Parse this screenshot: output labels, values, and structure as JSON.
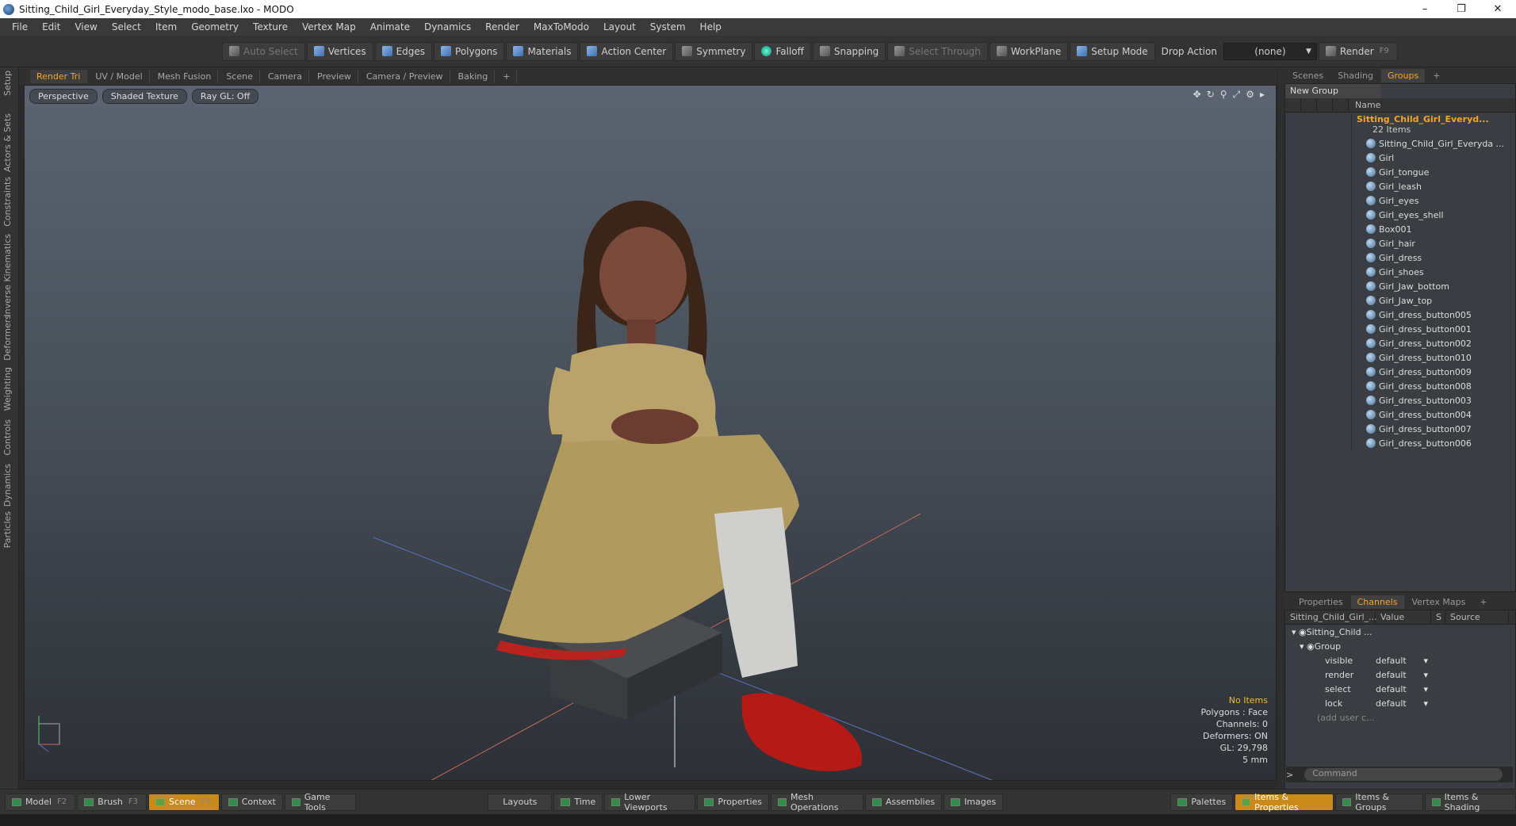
{
  "window": {
    "title": "Sitting_Child_Girl_Everyday_Style_modo_base.lxo - MODO",
    "minimize": "–",
    "maximize": "❐",
    "close": "✕"
  },
  "menu": [
    "File",
    "Edit",
    "View",
    "Select",
    "Item",
    "Geometry",
    "Texture",
    "Vertex Map",
    "Animate",
    "Dynamics",
    "Render",
    "MaxToModo",
    "Layout",
    "System",
    "Help"
  ],
  "toolbar": {
    "auto_select": "Auto Select",
    "vertices": "Vertices",
    "edges": "Edges",
    "polygons": "Polygons",
    "materials": "Materials",
    "action_center": "Action Center",
    "symmetry": "Symmetry",
    "falloff": "Falloff",
    "snapping": "Snapping",
    "select_through": "Select Through",
    "workplane": "WorkPlane",
    "setup_mode": "Setup Mode",
    "drop_action_label": "Drop Action",
    "drop_action_value": "(none)",
    "render": "Render",
    "render_key": "F9"
  },
  "left_tabs": [
    "Setup",
    "Actors & Sets",
    "Constraints",
    "Inverse Kinematics",
    "Deformers",
    "Weighting",
    "Controls",
    "Dynamics",
    "Particles"
  ],
  "viewport_tabs": [
    "Render Tri",
    "UV / Model",
    "Mesh Fusion",
    "Scene",
    "Camera",
    "Preview",
    "Camera / Preview",
    "Baking",
    "+"
  ],
  "viewport": {
    "view": "Perspective",
    "shading": "Shaded Texture",
    "raygl": "Ray GL: Off",
    "stats": {
      "items": "No Items",
      "polygons": "Polygons : Face",
      "channels": "Channels: 0",
      "deformers": "Deformers: ON",
      "gl": "GL: 29,798",
      "unit": "5 mm"
    }
  },
  "right_tabs": [
    "Scenes",
    "Shading",
    "Groups",
    "+"
  ],
  "groups": {
    "new_group": "New Group",
    "name_header": "Name",
    "root_name": "Sitting_Child_Girl_Everyd...",
    "root_count": "22 Items",
    "items": [
      "Sitting_Child_Girl_Everyda ...",
      "Girl",
      "Girl_tongue",
      "Girl_leash",
      "Girl_eyes",
      "Girl_eyes_shell",
      "Box001",
      "Girl_hair",
      "Girl_dress",
      "Girl_shoes",
      "Girl_Jaw_bottom",
      "Girl_Jaw_top",
      "Girl_dress_button005",
      "Girl_dress_button001",
      "Girl_dress_button002",
      "Girl_dress_button010",
      "Girl_dress_button009",
      "Girl_dress_button008",
      "Girl_dress_button003",
      "Girl_dress_button004",
      "Girl_dress_button007",
      "Girl_dress_button006"
    ]
  },
  "props_tabs": [
    "Properties",
    "Channels",
    "Vertex Maps",
    "+"
  ],
  "channels": {
    "headers": [
      "Sitting_Child_Girl_...",
      "Value",
      "S",
      "Source"
    ],
    "item": "Sitting_Child ...",
    "group": "Group",
    "rows": [
      {
        "name": "visible",
        "value": "default"
      },
      {
        "name": "render",
        "value": "default"
      },
      {
        "name": "select",
        "value": "default"
      },
      {
        "name": "lock",
        "value": "default"
      }
    ],
    "add_user": "(add user c..."
  },
  "command": {
    "placeholder": "Command"
  },
  "bottom": {
    "left": [
      {
        "label": "Model",
        "key": "F2"
      },
      {
        "label": "Brush",
        "key": "F3"
      },
      {
        "label": "Scene",
        "key": "F4"
      },
      {
        "label": "Context",
        "key": ""
      },
      {
        "label": "Game Tools",
        "key": ""
      }
    ],
    "center": [
      "Layouts",
      "Time",
      "Lower Viewports",
      "Properties",
      "Mesh Operations",
      "Assemblies",
      "Images"
    ],
    "right": [
      "Palettes",
      "Items & Properties",
      "Items & Groups",
      "Items & Shading"
    ]
  },
  "colors": {
    "accent": "#f5a623",
    "viewport_top": "#5b6470",
    "viewport_bottom": "#2d3136"
  }
}
